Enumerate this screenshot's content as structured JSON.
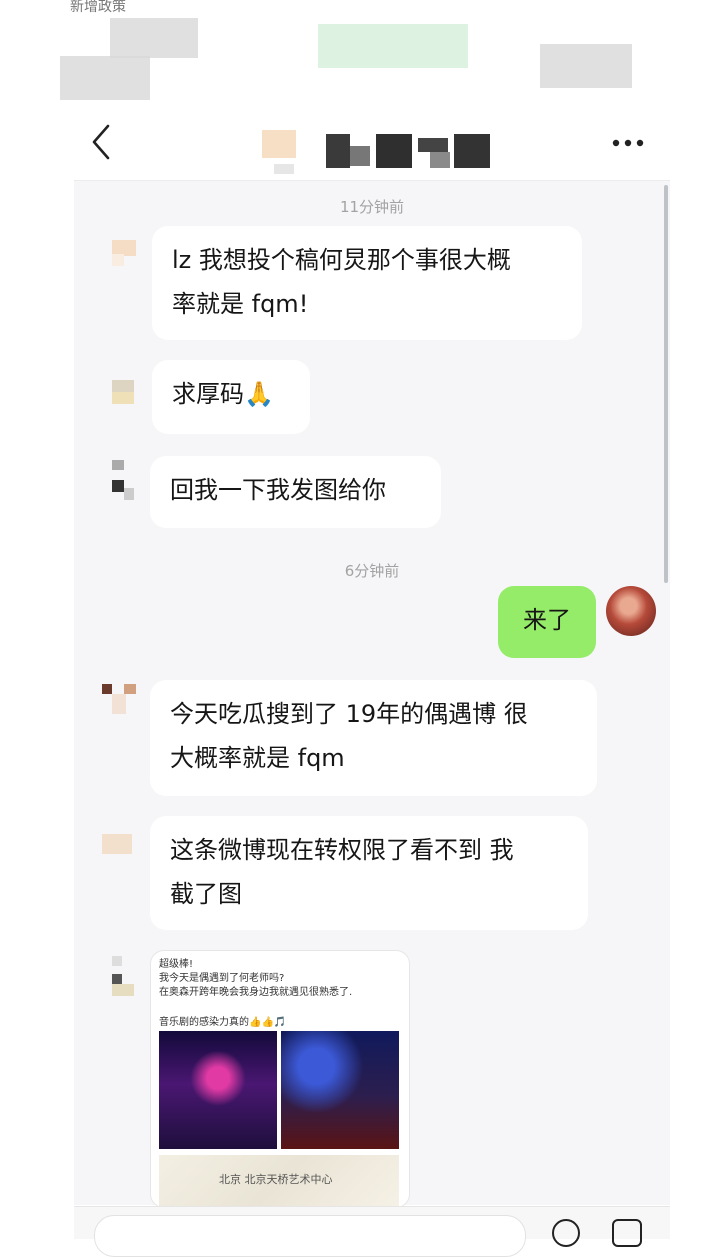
{
  "status_bar": {
    "left_text": "新增政策"
  },
  "chat": {
    "timestamps": [
      "11分钟前",
      "6分钟前"
    ],
    "messages": [
      {
        "from": "other",
        "text": "lz 我想投个稿何炅那个事很大概\n率就是 fqm!"
      },
      {
        "from": "other",
        "text": "求厚码🙏"
      },
      {
        "from": "other",
        "text": "回我一下我发图给你"
      },
      {
        "from": "me",
        "text": "来了"
      },
      {
        "from": "other",
        "text": "今天吃瓜搜到了 19年的偶遇博 很\n大概率就是 fqm"
      },
      {
        "from": "other",
        "text": "这条微博现在转权限了看不到 我\n截了图"
      }
    ],
    "image_message": {
      "lines": [
        "超级棒!",
        "我今天是偶遇到了何老师吗?",
        "在奥森开跨年晚会我身边我就遇见很熟悉了.",
        "音乐剧的感染力真的👍👍🎵"
      ],
      "map_label": "北京 北京天桥艺术中心"
    }
  },
  "colors": {
    "my_bubble": "#95ec69",
    "other_bubble": "#ffffff",
    "chat_background": "#f6f6f8"
  },
  "icons": [
    "back-arrow-icon",
    "more-dots-icon",
    "emoji-icon",
    "plus-icon"
  ]
}
